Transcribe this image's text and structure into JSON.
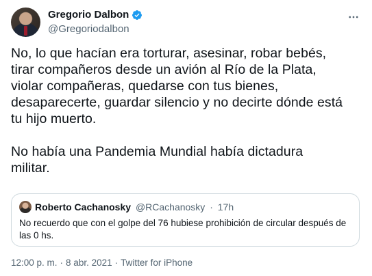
{
  "author": {
    "display_name": "Gregorio Dalbon",
    "handle": "@Gregoriodalbon",
    "verified": true,
    "verified_color": "#1d9bf0"
  },
  "tweet": {
    "text": "No, lo que hacían era torturar, asesinar, robar bebés,\ntirar compañeros desde un avión al Río de la Plata,\nviolar compañeras, quedarse con tus bienes,\ndesaparecerte, guardar silencio y no decirte dónde está\ntu hijo muerto.\n\nNo había una Pandemia Mundial había dictadura\nmilitar."
  },
  "quoted_tweet": {
    "display_name": "Roberto Cachanosky",
    "handle": "@RCachanosky",
    "separator": "·",
    "time": "17h",
    "text": "No recuerdo que con el golpe del 76 hubiese prohibición de circular después de las 0 hs."
  },
  "meta": {
    "time": "12:00 p. m.",
    "separator": "·",
    "date": "8 abr. 2021",
    "source": "Twitter for iPhone"
  },
  "icons": {
    "more": "more-horizontal-icon",
    "verified": "verified-badge-icon"
  },
  "colors": {
    "text": "#0f1419",
    "secondary": "#536471",
    "border": "#cfd9de",
    "accent": "#1d9bf0"
  }
}
